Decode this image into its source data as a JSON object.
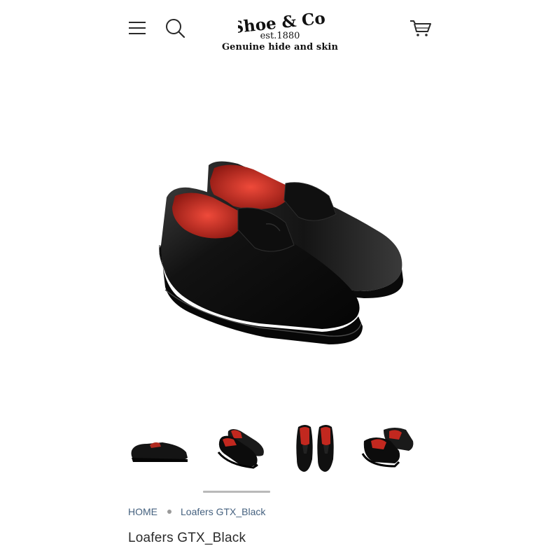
{
  "header": {
    "menu_icon": "hamburger-menu-icon",
    "search_icon": "search-icon",
    "cart_icon": "shopping-cart-icon",
    "logo": {
      "name": "Shoe & Co.",
      "est": "est.1880",
      "tagline": "Genuine hide and skin"
    }
  },
  "product": {
    "title": "Loafers GTX_Black",
    "thumbnails": [
      "side view",
      "angled pair view",
      "top-down pair view",
      "rear angled pair view"
    ],
    "active_thumbnail": 2
  },
  "breadcrumb": {
    "home": "HOME",
    "current": "Loafers GTX_Black"
  },
  "colors": {
    "leather": "#0d0d0d",
    "lining": "#d0281f",
    "link": "#45617f",
    "indicator": "#b9b9b9"
  }
}
